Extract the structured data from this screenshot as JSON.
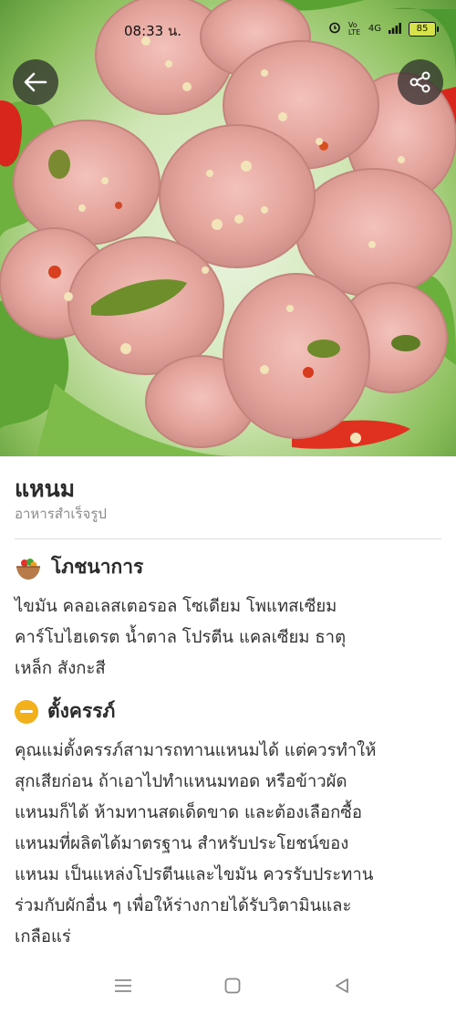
{
  "status_bar": {
    "time": "08:33 น.",
    "network": "4G",
    "volte": "Vo LTE",
    "battery": "85"
  },
  "hero": {
    "image": "naem-fermented-pork-sausage-photo"
  },
  "actions": {
    "back_icon": "arrow-left-icon",
    "share_icon": "share-icon"
  },
  "food": {
    "name": "แหนม",
    "category": "อาหารสำเร็จรูป"
  },
  "nutrition": {
    "icon": "food-bowl-icon",
    "heading": "โภชนาการ",
    "lines": [
      "ไขมัน คลอเลสเตอรอล โซเดียม โพแทสเซียม",
      "คาร์โบไฮเดรต น้ำตาล โปรตีน แคลเซียม ธาตุ",
      "เหล็ก สังกะสี"
    ]
  },
  "pregnancy": {
    "icon": "minus-circle-icon",
    "status_color": "#f2b01c",
    "heading": "ตั้งครรภ์",
    "lines": [
      "คุณแม่ตั้งครรภ์สามารถทานแหนมได้ แต่ควรทำให้",
      "สุกเสียก่อน ถ้าเอาไปทำแหนมทอด หรือข้าวผัด",
      "แหนมก็ได้ ห้ามทานสดเด็ดขาด และต้องเลือกซื้อ",
      "แหนมที่ผลิตได้มาตรฐาน สำหรับประโยชน์ของ",
      "แหนม เป็นแหล่งโปรตีนและไขมัน ควรรับประทาน",
      "ร่วมกับผักอื่น ๆ เพื่อให้ร่างกายได้รับวิตามินและ",
      "เกลือแร่"
    ]
  },
  "nav": {
    "recent_icon": "recent-apps-icon",
    "home_icon": "home-icon",
    "back_icon": "back-triangle-icon"
  }
}
